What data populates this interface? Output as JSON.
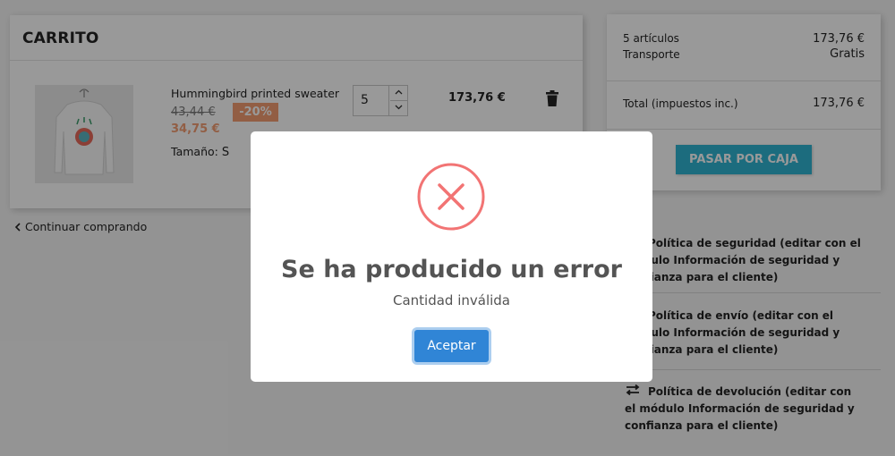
{
  "cart": {
    "title": "CARRITO",
    "product": {
      "name": "Hummingbird printed sweater",
      "old_price": "43,44 €",
      "discount": "-20%",
      "new_price": "34,75 €",
      "size_label": "Tamaño:",
      "size_value": "S",
      "quantity": "5",
      "line_total": "173,76 €"
    },
    "continue_label": "Continuar comprando"
  },
  "summary": {
    "items_label": "5 artículos",
    "items_value": "173,76 €",
    "shipping_label": "Transporte",
    "shipping_value": "Gratis",
    "total_label": "Total (impuestos inc.)",
    "total_value": "173,76 €",
    "checkout_label": "PASAR POR CAJA"
  },
  "reassurance": [
    {
      "icon": "shield-icon",
      "lines": [
        "Política de seguridad (editar con el",
        "módulo Información de seguridad y",
        "confianza para el cliente)"
      ]
    },
    {
      "icon": "truck-icon",
      "lines": [
        "Política de envío (editar con el",
        "módulo Información de seguridad y",
        "confianza para el cliente)"
      ]
    },
    {
      "icon": "swap-arrows-icon",
      "lines": [
        "Política de devolución (editar con",
        "el módulo Información de seguridad y",
        "confianza para el cliente)"
      ]
    }
  ],
  "modal": {
    "title": "Se ha producido un error",
    "text": "Cantidad inválida",
    "button": "Aceptar"
  },
  "colors": {
    "accent": "#2fb5d2",
    "discount": "#f39d72",
    "error": "#f27474",
    "confirm": "#3085d6"
  }
}
